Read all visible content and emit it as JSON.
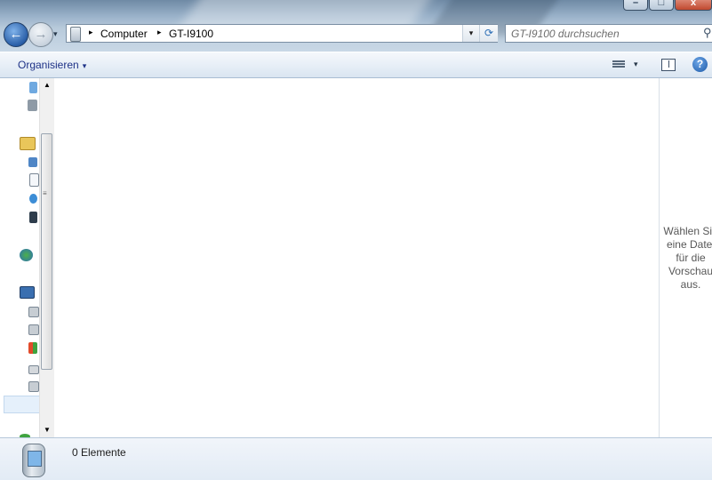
{
  "window": {
    "buttons": {
      "minimize": "–",
      "maximize": "□",
      "close": "x"
    }
  },
  "navigation": {
    "back_icon": "back-arrow-icon",
    "forward_icon": "forward-arrow-icon",
    "back_glyph": "←",
    "forward_glyph": "→",
    "history_glyph": "▾"
  },
  "address": {
    "separator": "▸",
    "crumbs": [
      "Computer",
      "GT-I9100"
    ],
    "dropdown_glyph": "▾",
    "refresh_glyph": "⟳"
  },
  "search": {
    "placeholder": "GT-I9100 durchsuchen",
    "icon_glyph": "⚲"
  },
  "commandbar": {
    "organize_label": "Organisieren",
    "caret": "▾",
    "help_glyph": "?"
  },
  "scrollbar": {
    "up": "▲",
    "down": "▼",
    "grip": "≡"
  },
  "preview": {
    "message": "Wählen Sie\neine Datei\nfür die\nVorschau\naus."
  },
  "details": {
    "item_count": "0 Elemente"
  },
  "colors": {
    "accent": "#1e3287",
    "selection": "#e5f0fb"
  }
}
